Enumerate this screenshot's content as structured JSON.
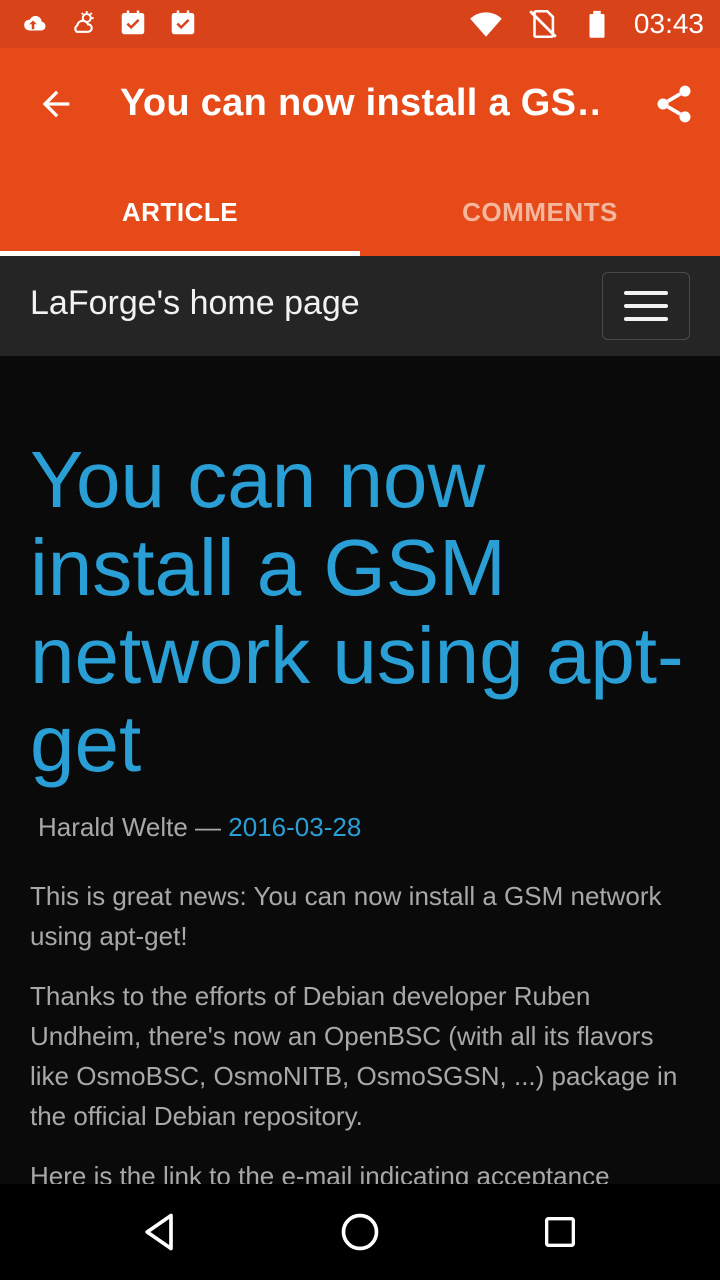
{
  "status_bar": {
    "time": "03:43",
    "left_icons": [
      "cloud-upload-icon",
      "weather-partly-sunny-icon",
      "task-done-icon",
      "task-done-icon"
    ],
    "right_icons": [
      "wifi-icon",
      "no-sim-icon",
      "battery-icon"
    ]
  },
  "app_bar": {
    "title": "You can now install a GS…",
    "back_icon": "arrow-back-icon",
    "share_icon": "share-icon"
  },
  "tabs": [
    {
      "label": "ARTICLE",
      "active": true
    },
    {
      "label": "COMMENTS",
      "active": false
    }
  ],
  "site_header": {
    "title": "LaForge's home page",
    "menu_icon": "hamburger-menu-icon"
  },
  "article": {
    "headline": "You can now install a GSM network using apt-get",
    "author": "Harald Welte",
    "separator": "—",
    "date": "2016-03-28",
    "paragraphs": [
      "This is great news: You can now install a GSM network using apt-get!",
      "Thanks to the efforts of Debian developer Ruben Undheim, there's now an OpenBSC (with all its flavors like OsmoBSC, OsmoNITB, OsmoSGSN, ...) package in the official Debian repository.",
      "Here is the link to the e-mail indicating acceptance"
    ]
  },
  "nav_bar": {
    "back_icon": "nav-back-icon",
    "home_icon": "nav-home-icon",
    "recents_icon": "nav-recents-icon"
  },
  "colors": {
    "status_bar": "#d8431a",
    "app_bar": "#e64a19",
    "site_header": "#252525",
    "background": "#0a0a0a",
    "link": "#2a9fd6",
    "body_text": "#a8a8a8"
  }
}
